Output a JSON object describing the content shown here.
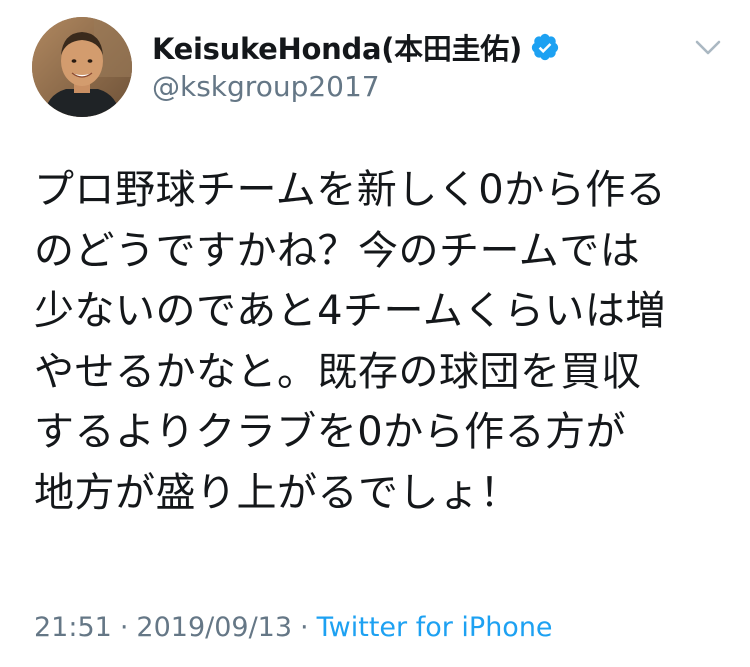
{
  "author": {
    "display_name": "KeisukeHonda(本田圭佑)",
    "handle": "@kskgroup2017",
    "verified": true
  },
  "tweet": {
    "lines": [
      "プロ野球チームを新しく0から作る",
      "のどうですかね？今のチームでは",
      "少ないのであと4チームくらいは増",
      "やせるかなと。既存の球団を買収",
      "するよりクラブを0から作る方が",
      "地方が盛り上がるでしょ！"
    ]
  },
  "meta": {
    "time": "21:51",
    "separator": "·",
    "date": "2019/09/13",
    "source": "Twitter for iPhone"
  },
  "icons": {
    "verified": "verified-badge-icon",
    "menu": "chevron-down-icon"
  },
  "colors": {
    "text": "#14171a",
    "secondary": "#657786",
    "accent": "#1da1f2"
  }
}
